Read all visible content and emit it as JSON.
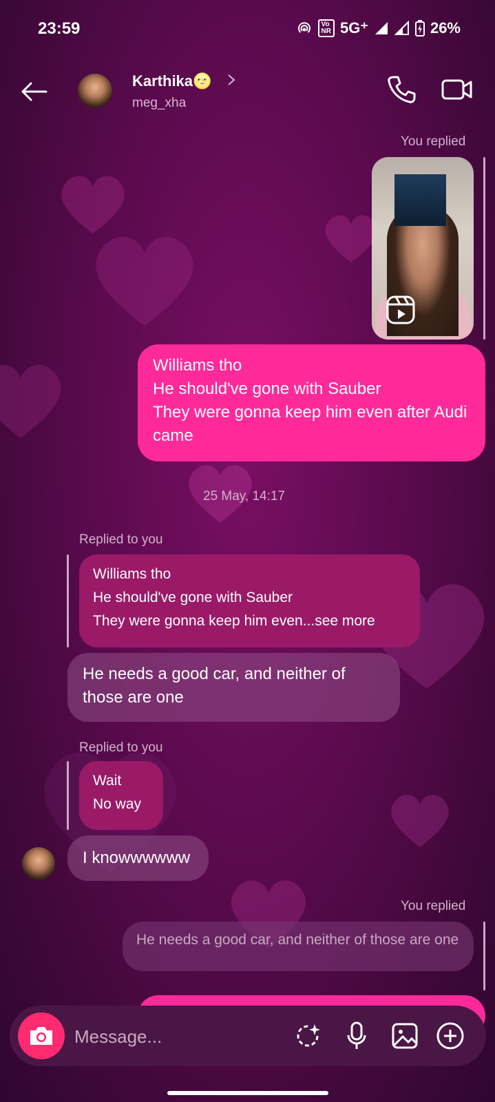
{
  "status": {
    "time": "23:59",
    "network": "5G⁺",
    "battery": "26%",
    "volte_top": "Vo",
    "volte_bottom": "NR"
  },
  "header": {
    "name": "Karthika🌝",
    "username": "meg_xha"
  },
  "messages": {
    "you_replied_1": "You replied",
    "sent_1": "Williams tho\nHe should've gone with Sauber\nThey were gonna keep him even after Audi came",
    "timestamp": "25 May, 14:17",
    "replied_to_you_1": "Replied to you",
    "quote_1": "Williams tho\nHe should've gone with Sauber\nThey were gonna keep him even...see more",
    "received_1": "He needs a good car, and neither of those are one",
    "replied_to_you_2": "Replied to you",
    "quote_2": "Wait\nNo way",
    "received_2": "I knowwwwww",
    "you_replied_2": "You replied",
    "quote_3": "He needs a good car, and neither of those are one"
  },
  "composer": {
    "placeholder": "Message..."
  },
  "colors": {
    "accent": "#ff2a9a",
    "camera": "#ff2a6f",
    "quote": "#9a1a68"
  },
  "icons": [
    "back-arrow-icon",
    "phone-icon",
    "video-icon",
    "reel-icon",
    "camera-icon",
    "sticker-icon",
    "mic-icon",
    "gallery-icon",
    "plus-icon"
  ]
}
